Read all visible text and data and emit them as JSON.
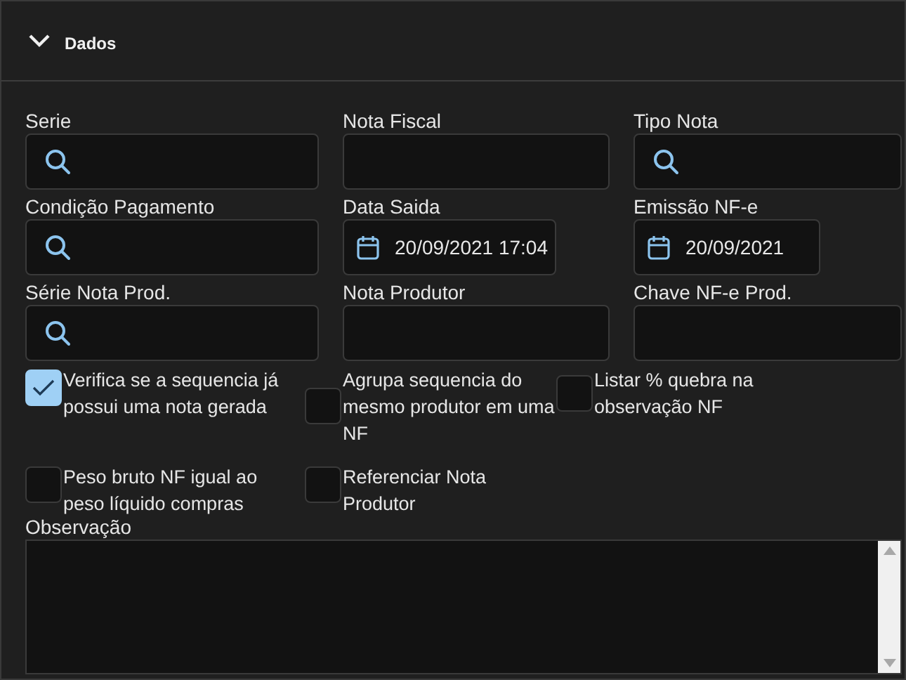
{
  "section": {
    "title": "Dados",
    "expanded": true
  },
  "fields": [
    {
      "label": "Serie",
      "kind": "search"
    },
    {
      "label": "Nota Fiscal",
      "kind": "text"
    },
    {
      "label": "Tipo Nota",
      "kind": "search"
    },
    {
      "label": "Condição Pagamento",
      "kind": "search"
    },
    {
      "label": "Data Saida",
      "kind": "date",
      "value": "20/09/2021 17:04"
    },
    {
      "label": "Emissão NF-e",
      "kind": "date",
      "value": "20/09/2021"
    },
    {
      "label": "Série Nota Prod.",
      "kind": "search"
    },
    {
      "label": "Nota Produtor",
      "kind": "text"
    },
    {
      "label": "Chave NF-e Prod.",
      "kind": "text"
    }
  ],
  "checkboxes": [
    {
      "label": "Verifica se a sequencia já possui uma nota gerada",
      "checked": true
    },
    {
      "label": "Agrupa sequencia do mesmo produtor em uma NF",
      "checked": false
    },
    {
      "label": "Listar % quebra na observação NF",
      "checked": false
    },
    {
      "label": "Peso bruto NF igual ao peso líquido compras",
      "checked": false
    },
    {
      "label": "Referenciar Nota Produtor",
      "checked": false
    }
  ],
  "observation": {
    "label": "Observação"
  }
}
